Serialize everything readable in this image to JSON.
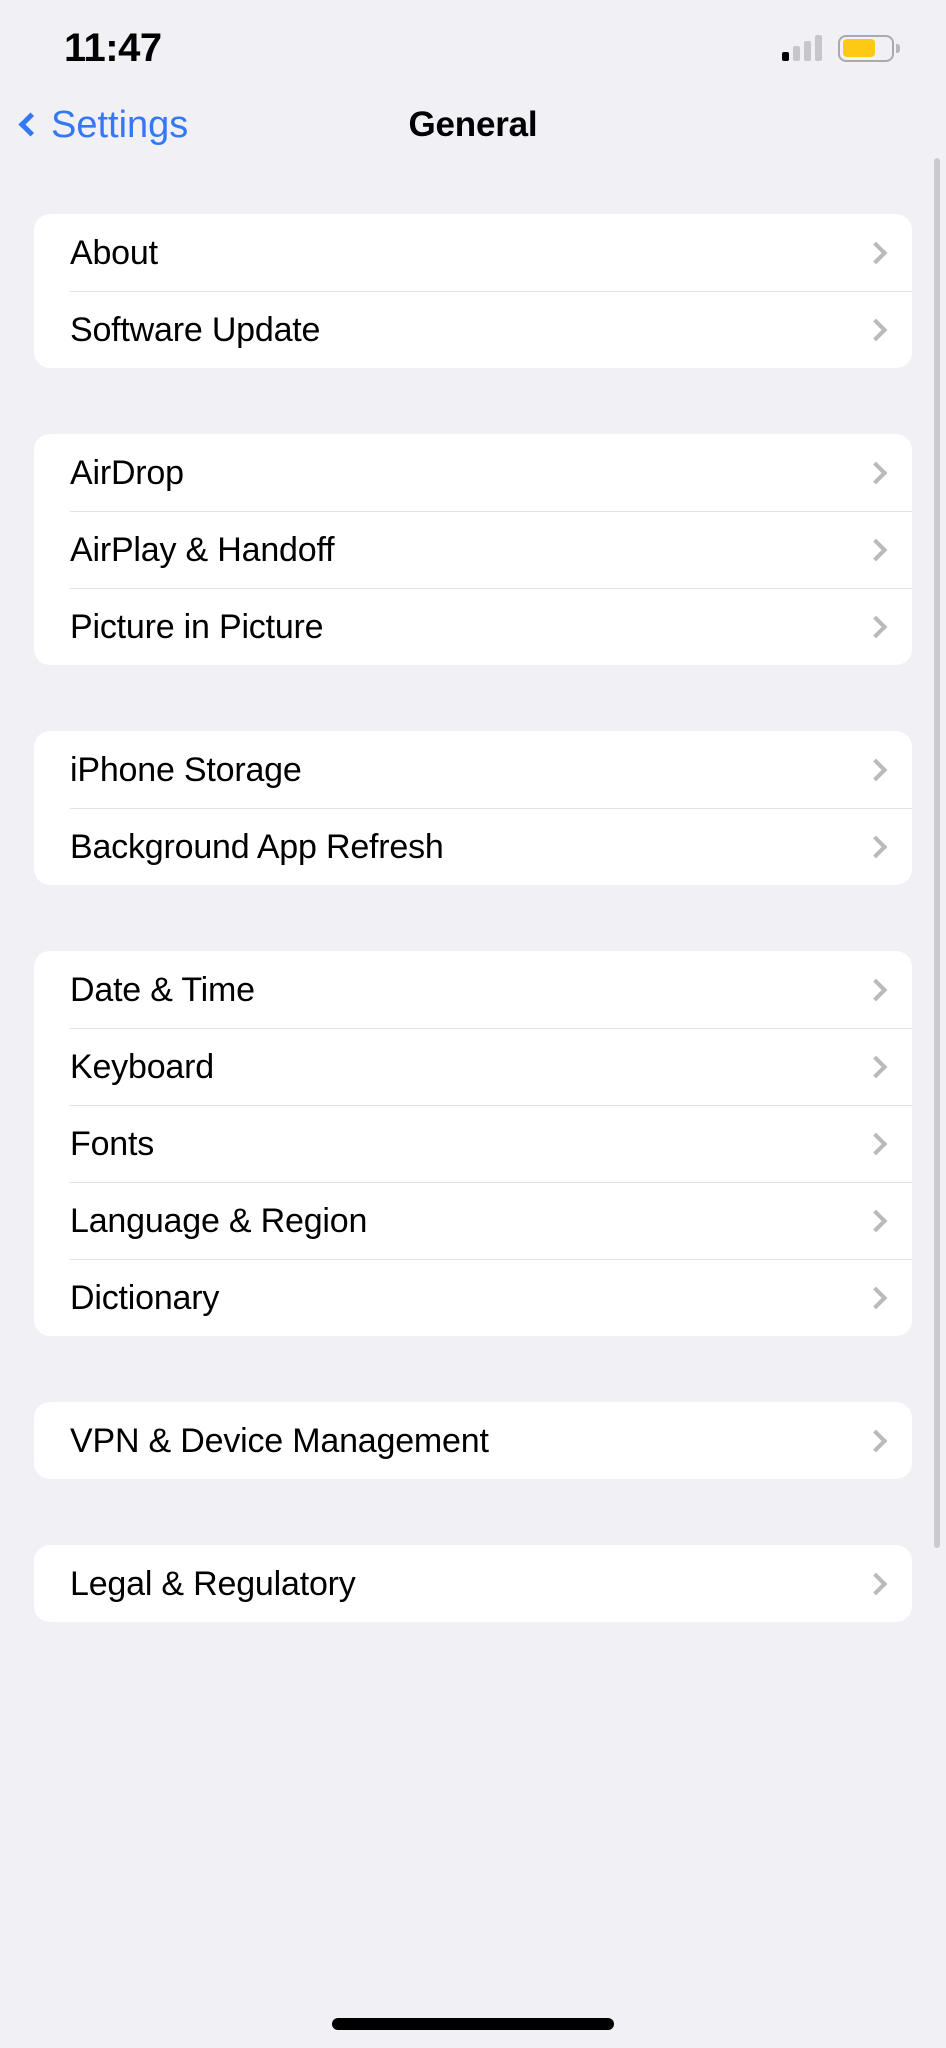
{
  "status_bar": {
    "time": "11:47",
    "signal_icon": "cellular-signal-icon",
    "signal_bars_total": 4,
    "signal_bars_active": 1,
    "battery_icon": "battery-icon",
    "battery_level_percent": 70,
    "battery_color": "#fcc914"
  },
  "nav_bar": {
    "back_label": "Settings",
    "back_icon": "chevron-left-icon",
    "title": "General",
    "accent_color": "#3478f6"
  },
  "colors": {
    "page_background": "#f0f0f5",
    "card_background": "#ffffff",
    "separator": "#e2e2e6",
    "chevron": "#b9b9be",
    "label": "#000000"
  },
  "groups": [
    {
      "id": "device-info",
      "rows": [
        {
          "label": "About",
          "accessory": "chevron-right-icon"
        },
        {
          "label": "Software Update",
          "accessory": "chevron-right-icon"
        }
      ]
    },
    {
      "id": "sharing",
      "rows": [
        {
          "label": "AirDrop",
          "accessory": "chevron-right-icon"
        },
        {
          "label": "AirPlay & Handoff",
          "accessory": "chevron-right-icon"
        },
        {
          "label": "Picture in Picture",
          "accessory": "chevron-right-icon"
        }
      ]
    },
    {
      "id": "storage",
      "rows": [
        {
          "label": "iPhone Storage",
          "accessory": "chevron-right-icon"
        },
        {
          "label": "Background App Refresh",
          "accessory": "chevron-right-icon"
        }
      ]
    },
    {
      "id": "localization",
      "rows": [
        {
          "label": "Date & Time",
          "accessory": "chevron-right-icon"
        },
        {
          "label": "Keyboard",
          "accessory": "chevron-right-icon"
        },
        {
          "label": "Fonts",
          "accessory": "chevron-right-icon"
        },
        {
          "label": "Language & Region",
          "accessory": "chevron-right-icon"
        },
        {
          "label": "Dictionary",
          "accessory": "chevron-right-icon"
        }
      ]
    },
    {
      "id": "management",
      "rows": [
        {
          "label": "VPN & Device Management",
          "accessory": "chevron-right-icon"
        }
      ]
    },
    {
      "id": "legal",
      "rows": [
        {
          "label": "Legal & Regulatory",
          "accessory": "chevron-right-icon"
        }
      ]
    }
  ]
}
